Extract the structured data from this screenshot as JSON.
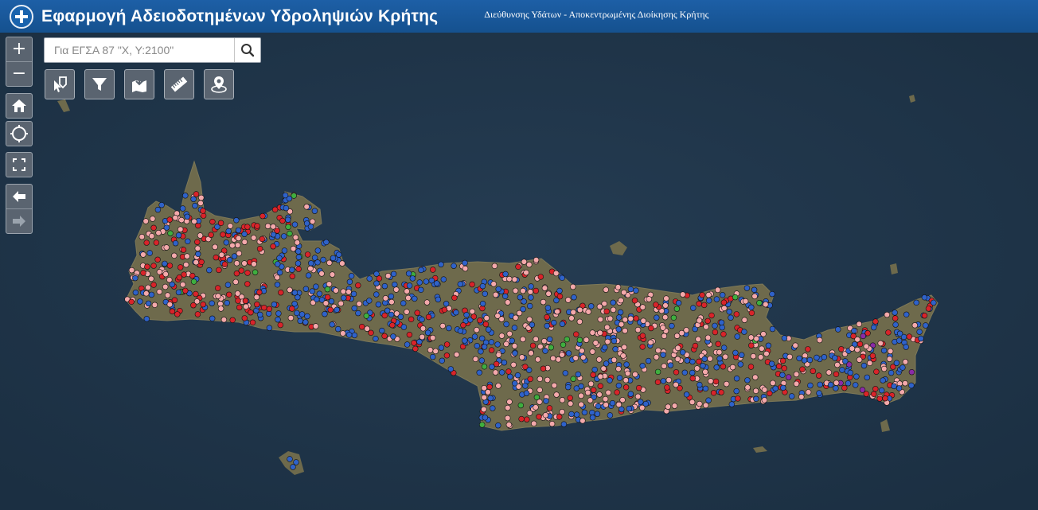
{
  "header": {
    "title": "Εφαρμογή Αδειοδοτημένων Υδροληψιών Κρήτης",
    "subtitle": "Διεύθυνσης Υδάτων - Αποκεντρωμένης Διοίκησης Κρήτης"
  },
  "search": {
    "placeholder": "Για ΕΓΣΑ 87 \"Χ, Υ:2100\""
  },
  "zoom": {
    "in_label": "+",
    "out_label": "−"
  },
  "icons": {
    "logo": "greek-cross-emblem-icon",
    "search": "search-icon",
    "home": "home-icon",
    "locate": "locate-icon",
    "fullscreen": "fullscreen-icon",
    "back": "arrow-left-icon",
    "forward": "arrow-right-icon",
    "select": "select-tool-icon",
    "filter": "filter-icon",
    "print": "print-icon",
    "measure": "ruler-icon",
    "locate_coords": "map-pin-icon"
  },
  "colors": {
    "header": "#1a5ca3",
    "sea": "#1f3447",
    "land": "#6e6a4c",
    "point_blue": "#2f62c9",
    "point_pink": "#f4a9ab",
    "point_red": "#d8242a",
    "point_green": "#3fae3f",
    "point_purple": "#8a2ba6"
  }
}
